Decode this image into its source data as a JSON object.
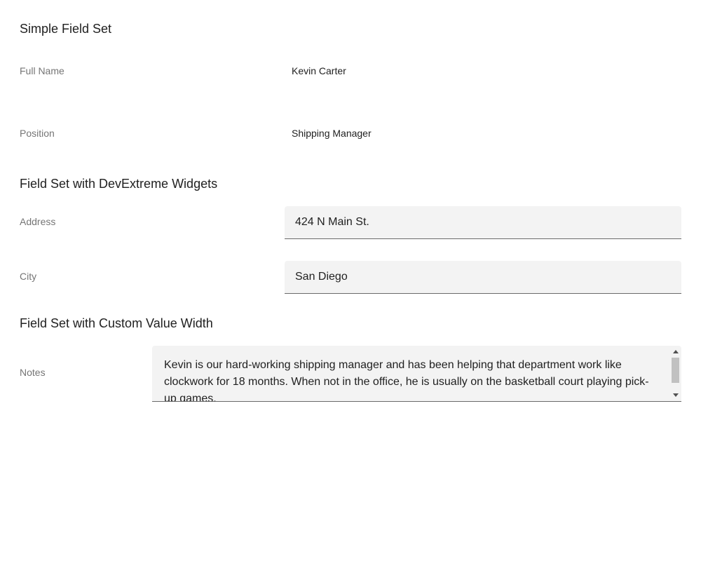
{
  "sections": [
    {
      "title": "Simple Field Set",
      "fields": [
        {
          "label": "Full Name",
          "value": "Kevin Carter"
        },
        {
          "label": "Position",
          "value": "Shipping Manager"
        }
      ]
    },
    {
      "title": "Field Set with DevExtreme Widgets",
      "fields": [
        {
          "label": "Address",
          "value": "424 N Main St."
        },
        {
          "label": "City",
          "value": "San Diego"
        }
      ]
    },
    {
      "title": "Field Set with Custom Value Width",
      "fields": [
        {
          "label": "Notes",
          "value": "Kevin is our hard-working shipping manager and has been helping that department work like clockwork for 18 months. When not in the office, he is usually on the basketball court playing pick-up games."
        }
      ]
    }
  ],
  "icons": {
    "scroll_up": "scroll-up-arrow-icon",
    "scroll_down": "scroll-down-arrow-icon"
  },
  "colors": {
    "input_background": "#f3f3f3",
    "label_text": "#757575",
    "value_text": "#212121",
    "underline": "#6b6b6b"
  }
}
